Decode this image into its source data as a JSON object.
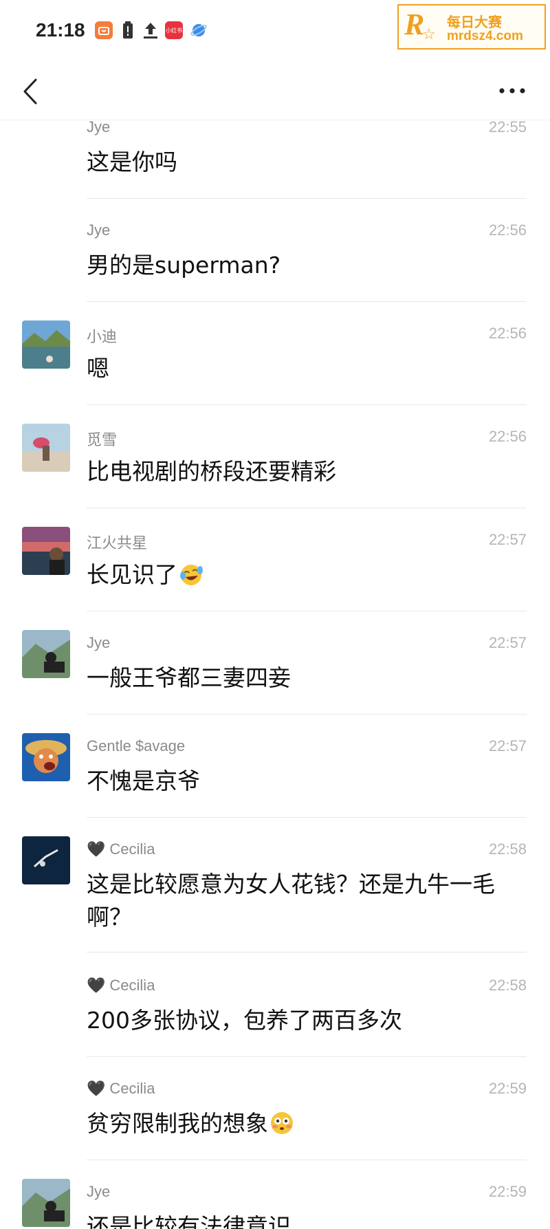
{
  "status_bar": {
    "time": "21:18",
    "icons": [
      "taobao-icon",
      "battery-alert-icon",
      "upload-icon",
      "xiaohongshu-icon",
      "browser-icon"
    ],
    "app_badge": "小红书"
  },
  "watermark": {
    "letter": "R",
    "title": "每日大赛",
    "url": "mrdsz4.com"
  },
  "nav": {
    "back_icon": "chevron-left-icon",
    "more_icon": "more-horizontal-icon"
  },
  "messages": [
    {
      "sender": "Jye",
      "time": "22:55",
      "text": "这是你吗",
      "avatar": null
    },
    {
      "sender": "Jye",
      "time": "22:56",
      "text": "男的是superman?",
      "avatar": null
    },
    {
      "sender": "小迪",
      "time": "22:56",
      "text": "嗯",
      "avatar": "landscape-lake"
    },
    {
      "sender": "觅雪",
      "time": "22:56",
      "text": "比电视剧的桥段还要精彩",
      "avatar": "beach-person"
    },
    {
      "sender": "江火共星",
      "time": "22:57",
      "text": "长见识了",
      "emoji": "laughing-tears-emoji",
      "avatar": "sunset-portrait"
    },
    {
      "sender": "Jye",
      "time": "22:57",
      "text": "一般王爷都三妻四妾",
      "avatar": "mountain-photographer"
    },
    {
      "sender": "Gentle $avage",
      "time": "22:57",
      "text": "不愧是京爷",
      "avatar": "cartoon-straw-hat"
    },
    {
      "sender": "Cecilia",
      "time": "22:58",
      "text": "这是比较愿意为女人花钱？还是九牛一毛啊？",
      "avatar": "dark-sky-diver",
      "heart": true
    },
    {
      "sender": "Cecilia",
      "time": "22:58",
      "text": "200多张协议，包养了两百多次",
      "avatar": null,
      "heart": true
    },
    {
      "sender": "Cecilia",
      "time": "22:59",
      "text": "贫穷限制我的想象",
      "emoji": "flushed-face-emoji",
      "avatar": null,
      "heart": true
    },
    {
      "sender": "Jye",
      "time": "22:59",
      "text": "还是比较有法律意识",
      "avatar": "mountain-photographer"
    }
  ],
  "colors": {
    "watermark": "#f0a020",
    "timestamp": "#b5b5b5",
    "sender": "#8a8a8a",
    "divider": "#e8e8e8"
  }
}
